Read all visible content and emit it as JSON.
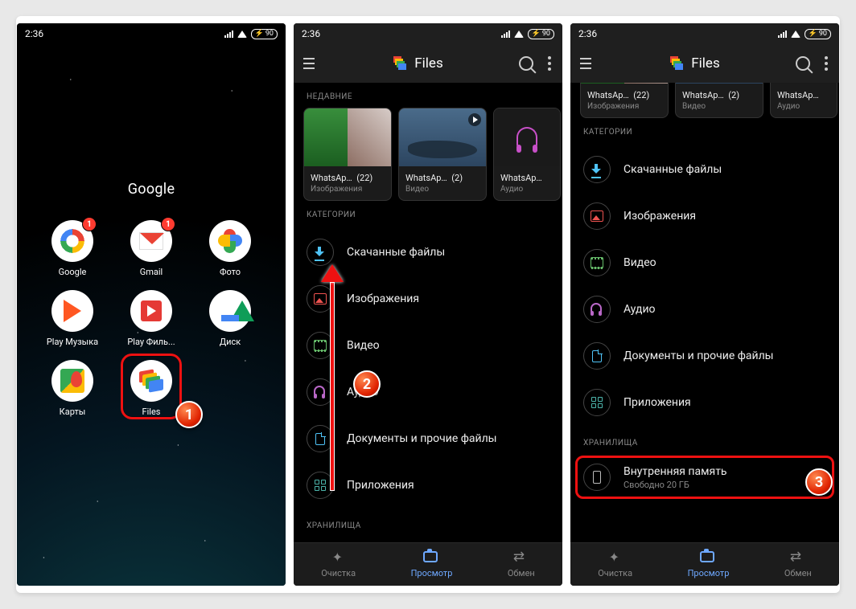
{
  "status": {
    "time": "2:36",
    "battery": "90"
  },
  "screen1": {
    "folder_title": "Google",
    "apps": [
      {
        "name": "Google",
        "badge": "1"
      },
      {
        "name": "Gmail",
        "badge": "1"
      },
      {
        "name": "Фото"
      },
      {
        "name": "Play Музыка"
      },
      {
        "name": "Play Филь..."
      },
      {
        "name": "Диск"
      },
      {
        "name": "Карты"
      },
      {
        "name": "Files"
      }
    ],
    "step_badge": "1"
  },
  "files_app": {
    "title": "Files",
    "sections": {
      "recent": "НЕДАВНИЕ",
      "categories": "КАТЕГОРИИ",
      "storage": "ХРАНИЛИЩА"
    },
    "recent_cards": [
      {
        "title": "WhatsAp…",
        "count": "(22)",
        "sub": "Изображения"
      },
      {
        "title": "WhatsAp…",
        "count": "(2)",
        "sub": "Видео"
      },
      {
        "title": "WhatsAp…",
        "count": "",
        "sub": "Аудио"
      }
    ],
    "categories": [
      {
        "label": "Скачанные файлы"
      },
      {
        "label": "Изображения"
      },
      {
        "label": "Видео"
      },
      {
        "label": "Аудио"
      },
      {
        "label": "Документы и прочие файлы"
      },
      {
        "label": "Приложения"
      }
    ],
    "storage": {
      "label": "Внутренняя память",
      "sub": "Свободно 20 ГБ"
    },
    "nav": {
      "clean": "Очистка",
      "browse": "Просмотр",
      "share": "Обмен"
    }
  },
  "screen2": {
    "step_badge": "2"
  },
  "screen3": {
    "step_badge": "3"
  }
}
